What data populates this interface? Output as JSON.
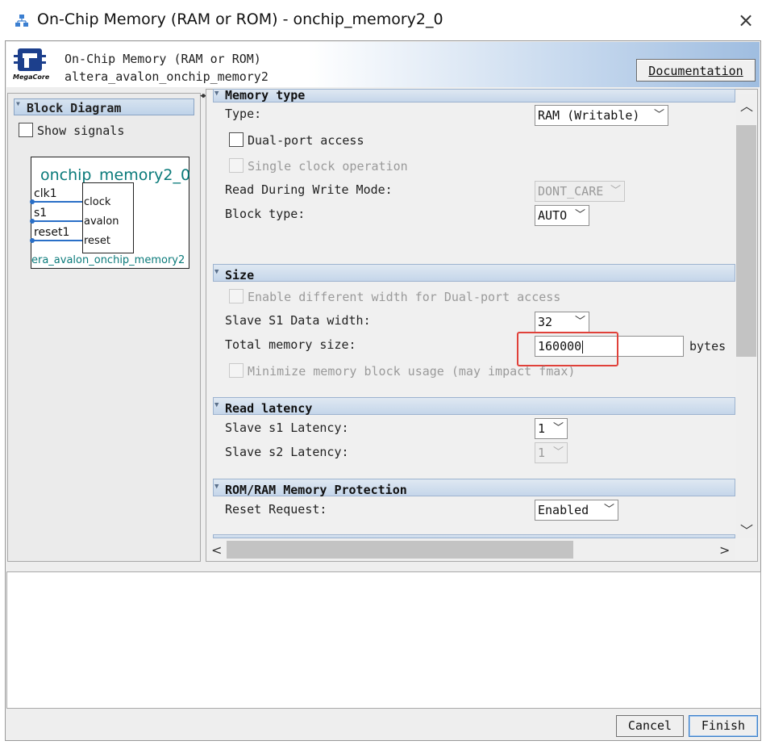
{
  "window": {
    "title": "On-Chip Memory (RAM or ROM) - onchip_memory2_0",
    "close_icon": "×"
  },
  "header": {
    "line1": "On-Chip Memory (RAM or ROM)",
    "line2": "altera_avalon_onchip_memory2",
    "logo_text": "MegaCore",
    "documentation_label": "Documentation"
  },
  "block_diagram": {
    "title": "Block Diagram",
    "show_signals_label": "Show signals",
    "instance_name": "onchip_memory2_0",
    "ports_out": [
      "clk1",
      "s1",
      "reset1"
    ],
    "ports_in": [
      "clock",
      "avalon",
      "reset"
    ],
    "component_type": "era_avalon_onchip_memory2"
  },
  "memory_type": {
    "title": "Memory type",
    "type_label": "Type:",
    "type_value": "RAM (Writable)",
    "dual_port_label": "Dual-port access",
    "single_clock_label": "Single clock operation",
    "rdw_label": "Read During Write Mode:",
    "rdw_value": "DONT_CARE",
    "block_type_label": "Block type:",
    "block_type_value": "AUTO"
  },
  "size": {
    "title": "Size",
    "diff_width_label": "Enable different width for Dual-port access",
    "data_width_label": "Slave S1 Data width:",
    "data_width_value": "32",
    "total_size_label": "Total memory size:",
    "total_size_value": "160000",
    "bytes_label": "bytes",
    "minimize_label": "Minimize memory block usage (may impact fmax)"
  },
  "read_latency": {
    "title": "Read latency",
    "s1_label": "Slave s1 Latency:",
    "s1_value": "1",
    "s2_label": "Slave s2 Latency:",
    "s2_value": "1"
  },
  "protection": {
    "title": "ROM/RAM Memory Protection",
    "reset_label": "Reset Request:",
    "reset_value": "Enabled"
  },
  "buttons": {
    "cancel": "Cancel",
    "finish": "Finish"
  },
  "colors": {
    "highlight": "#e0413a",
    "diagram_text": "#0a7a7a",
    "wire": "#2a6fc7"
  }
}
